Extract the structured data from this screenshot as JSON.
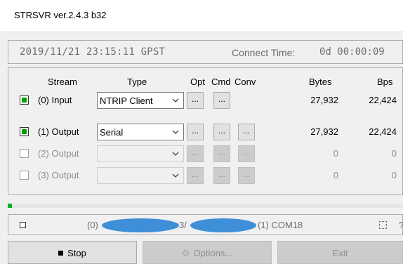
{
  "window": {
    "title": "STRSVR ver.2.4.3 b32"
  },
  "status": {
    "datetime": "2019/11/21 23:15:11 GPST",
    "connect_label": "Connect Time:",
    "connect_value": "0d 00:00:09"
  },
  "table": {
    "headers": {
      "stream": "Stream",
      "type": "Type",
      "opt": "Opt",
      "cmd": "Cmd",
      "conv": "Conv",
      "bytes": "Bytes",
      "bps": "Bps"
    },
    "rows": [
      {
        "checked": true,
        "enabled": true,
        "label": "(0) Input",
        "type": "NTRIP Client",
        "opt": "...",
        "cmd": "...",
        "conv": "",
        "bytes": "27,932",
        "bps": "22,424"
      },
      {
        "checked": true,
        "enabled": true,
        "label": "(1) Output",
        "type": "Serial",
        "opt": "...",
        "cmd": "...",
        "conv": "...",
        "bytes": "27,932",
        "bps": "22,424"
      },
      {
        "checked": false,
        "enabled": false,
        "label": "(2) Output",
        "type": "",
        "opt": "...",
        "cmd": "...",
        "conv": "...",
        "bytes": "0",
        "bps": "0"
      },
      {
        "checked": false,
        "enabled": false,
        "label": "(3) Output",
        "type": "",
        "opt": "...",
        "cmd": "...",
        "conv": "...",
        "bytes": "0",
        "bps": "0"
      }
    ]
  },
  "progress": {
    "value": 0.01,
    "color": "#06b025"
  },
  "message": {
    "part0": "(0)",
    "part1": "3/",
    "part2": "(1) COM18",
    "help": "?"
  },
  "buttons": {
    "stop": "Stop",
    "options": "Options...",
    "exit": "Exit"
  }
}
